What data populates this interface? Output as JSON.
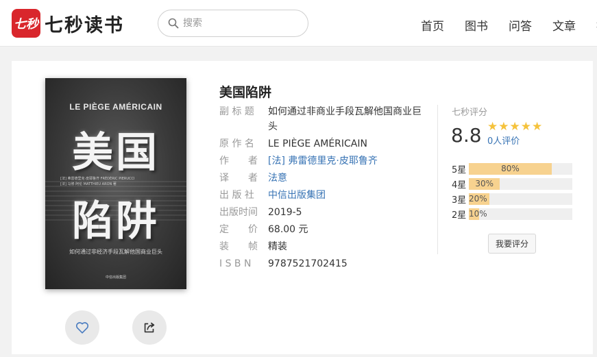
{
  "header": {
    "logo_mark": "七秒",
    "logo_text": "七秒读书",
    "search_placeholder": "搜索",
    "nav": [
      "首页",
      "图书",
      "问答",
      "文章",
      "控"
    ]
  },
  "book": {
    "title": "美国陷阱",
    "cover": {
      "title_en": "LE PIÈGE AMÉRICAIN",
      "title_zh_line1": "美国",
      "title_zh_line2": "陷阱",
      "authors_small": "[法] 弗雷德里克·皮耶鲁齐 FRÉDÉRIC PIERUCCI\n[法] 马修·阿伦 MATTHIEU ARON 著",
      "subtitle": "如何通过非经济手段瓦解他国商业巨头",
      "publisher": "中信出版集团"
    },
    "fields": [
      {
        "label": "副 标 题",
        "value": "如何通过非商业手段瓦解他国商业巨头",
        "link": false
      },
      {
        "label": "原 作 名",
        "value": "LE PIÈGE AMÉRICAIN",
        "link": false
      },
      {
        "label": "作　　者",
        "value": "[法] 弗雷德里克·皮耶鲁齐",
        "link": true
      },
      {
        "label": "译　　者",
        "value": "法意",
        "link": true
      },
      {
        "label": "出 版 社",
        "value": "中信出版集团",
        "link": true
      },
      {
        "label": "出版时间",
        "value": "2019-5",
        "link": false
      },
      {
        "label": "定　　价",
        "value": "68.00 元",
        "link": false
      },
      {
        "label": "装　　帧",
        "value": "精装",
        "link": false
      },
      {
        "label": "I S B N",
        "value": "9787521702415",
        "link": false
      }
    ]
  },
  "rating": {
    "label": "七秒评分",
    "score": "8.8",
    "stars": 5,
    "count": "0人评价",
    "bars": [
      {
        "star": "5星",
        "pct": "80%",
        "value": 0.8
      },
      {
        "star": "4星",
        "pct": "30%",
        "value": 0.3
      },
      {
        "star": "3星",
        "pct": "20%",
        "value": 0.2
      },
      {
        "star": "2星",
        "pct": "10%",
        "value": 0.1
      }
    ],
    "button": "我要评分"
  },
  "icons": {
    "like": "heart-icon",
    "share": "share-icon",
    "search": "search-icon"
  },
  "colors": {
    "brand": "#d9262c",
    "link": "#3773b4",
    "star": "#f5c23b",
    "bar_fill": "#f7d28f"
  }
}
